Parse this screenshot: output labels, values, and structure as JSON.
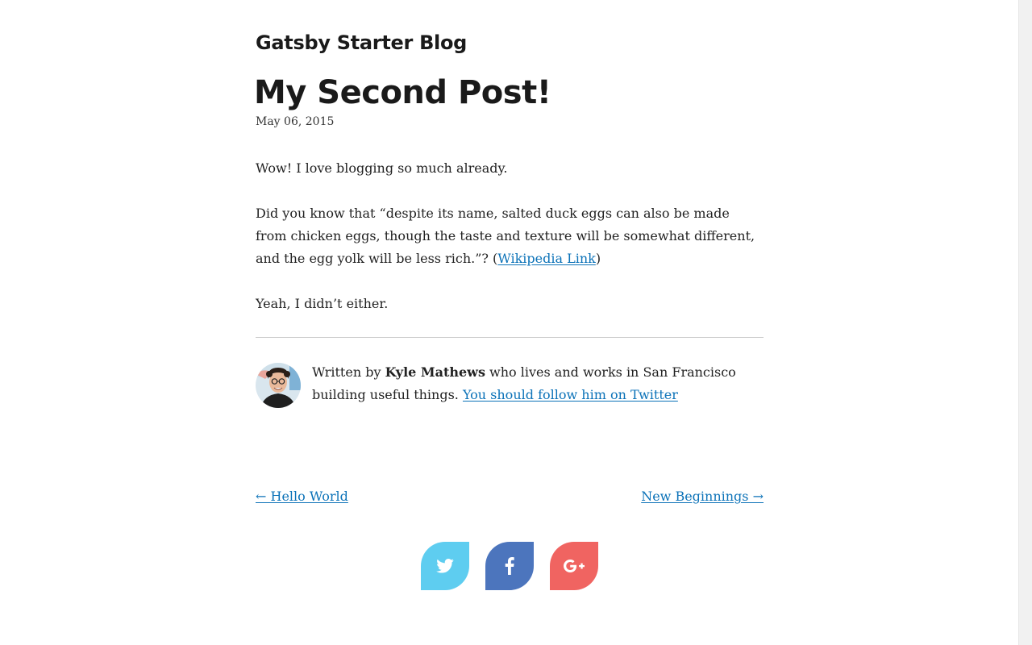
{
  "site": {
    "title": "Gatsby Starter Blog"
  },
  "post": {
    "title": "My Second Post!",
    "date": "May 06, 2015",
    "paragraphs": {
      "p1": "Wow! I love blogging so much already.",
      "p2_before": "Did you know that “despite its name, salted duck eggs can also be made from chicken eggs, though the taste and texture will be somewhat different, and the egg yolk will be less rich.”? (",
      "p2_link": "Wikipedia Link",
      "p2_after": ")",
      "p3": "Yeah, I didn’t either."
    }
  },
  "bio": {
    "prefix": "Written by ",
    "author": "Kyle Mathews",
    "suffix": " who lives and works in San Francisco building useful things. ",
    "twitter_link": "You should follow him on Twitter"
  },
  "nav": {
    "prev": "← Hello World",
    "next": "New Beginnings →"
  },
  "share": {
    "buttons": [
      {
        "icon": "twitter-icon",
        "color": "#5ecdf0"
      },
      {
        "icon": "facebook-icon",
        "color": "#4c75bd"
      },
      {
        "icon": "google-plus-icon",
        "color": "#f06461"
      }
    ]
  },
  "colors": {
    "link": "#0b72b8",
    "text": "#222222",
    "heading": "#1a1a1a"
  }
}
